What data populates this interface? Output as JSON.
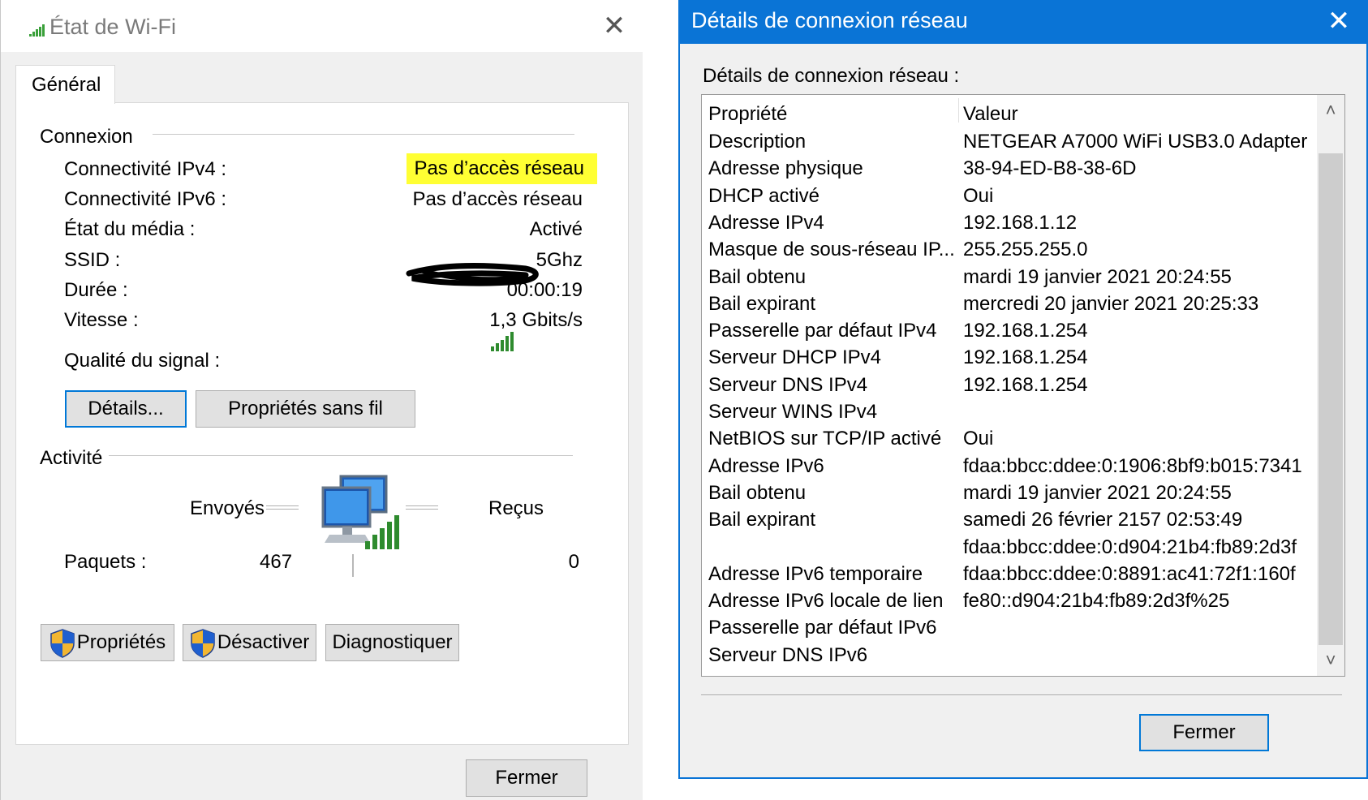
{
  "wifi_window": {
    "title": "État de Wi-Fi",
    "close_glyph": "✕",
    "tab": "Général",
    "connection": {
      "heading": "Connexion",
      "ipv4_label": "Connectivité IPv4 :",
      "ipv4_value": "Pas d’accès réseau",
      "ipv6_label": "Connectivité IPv6 :",
      "ipv6_value": "Pas d’accès réseau",
      "media_label": "État du média :",
      "media_value": "Activé",
      "ssid_label": "SSID :",
      "ssid_value_visible": "5Ghz",
      "duration_label": "Durée :",
      "duration_value": "00:00:19",
      "speed_label": "Vitesse :",
      "speed_value": "1,3 Gbits/s",
      "signal_label": "Qualité du signal :"
    },
    "buttons": {
      "details": "Détails...",
      "wireless_props": "Propriétés sans fil",
      "properties": "Propriétés",
      "disable": "Désactiver",
      "diagnose": "Diagnostiquer",
      "close": "Fermer"
    },
    "activity": {
      "heading": "Activité",
      "sent_label": "Envoyés",
      "received_label": "Reçus",
      "packets_label": "Paquets :",
      "packets_sent": "467",
      "packets_received": "0"
    },
    "icons": [
      "wifi-signal-icon",
      "signal-quality-icon",
      "network-computers-icon",
      "uac-shield-icon",
      "close-icon"
    ]
  },
  "details_window": {
    "title": "Détails de connexion réseau",
    "close_glyph": "✕",
    "list_label": "Détails de connexion réseau :",
    "columns": {
      "property": "Propriété",
      "value": "Valeur"
    },
    "rows": [
      {
        "p": "Description",
        "v": "NETGEAR A7000 WiFi USB3.0 Adapter"
      },
      {
        "p": "Adresse physique",
        "v": "38-94-ED-B8-38-6D"
      },
      {
        "p": "DHCP activé",
        "v": "Oui"
      },
      {
        "p": "Adresse IPv4",
        "v": "192.168.1.12"
      },
      {
        "p": "Masque de sous-réseau IP...",
        "v": "255.255.255.0"
      },
      {
        "p": "Bail obtenu",
        "v": "mardi 19 janvier 2021 20:24:55"
      },
      {
        "p": "Bail expirant",
        "v": "mercredi 20 janvier 2021 20:25:33"
      },
      {
        "p": "Passerelle par défaut IPv4",
        "v": "192.168.1.254"
      },
      {
        "p": "Serveur DHCP IPv4",
        "v": "192.168.1.254"
      },
      {
        "p": "Serveur DNS IPv4",
        "v": "192.168.1.254"
      },
      {
        "p": "Serveur WINS IPv4",
        "v": ""
      },
      {
        "p": "NetBIOS sur TCP/IP activé",
        "v": "Oui"
      },
      {
        "p": "Adresse IPv6",
        "v": "fdaa:bbcc:ddee:0:1906:8bf9:b015:7341"
      },
      {
        "p": "Bail obtenu",
        "v": "mardi 19 janvier 2021 20:24:55"
      },
      {
        "p": "Bail expirant",
        "v": "samedi 26 février 2157 02:53:49"
      },
      {
        "p": "",
        "v": "fdaa:bbcc:ddee:0:d904:21b4:fb89:2d3f"
      },
      {
        "p": "Adresse IPv6 temporaire",
        "v": "fdaa:bbcc:ddee:0:8891:ac41:72f1:160f"
      },
      {
        "p": "Adresse IPv6 locale de lien",
        "v": "fe80::d904:21b4:fb89:2d3f%25"
      },
      {
        "p": "Passerelle par défaut IPv6",
        "v": ""
      },
      {
        "p": "Serveur DNS IPv6",
        "v": ""
      }
    ],
    "scroll_up_glyph": "˄",
    "scroll_down_glyph": "˅",
    "close_button": "Fermer",
    "accent_color": "#0a74d6"
  }
}
